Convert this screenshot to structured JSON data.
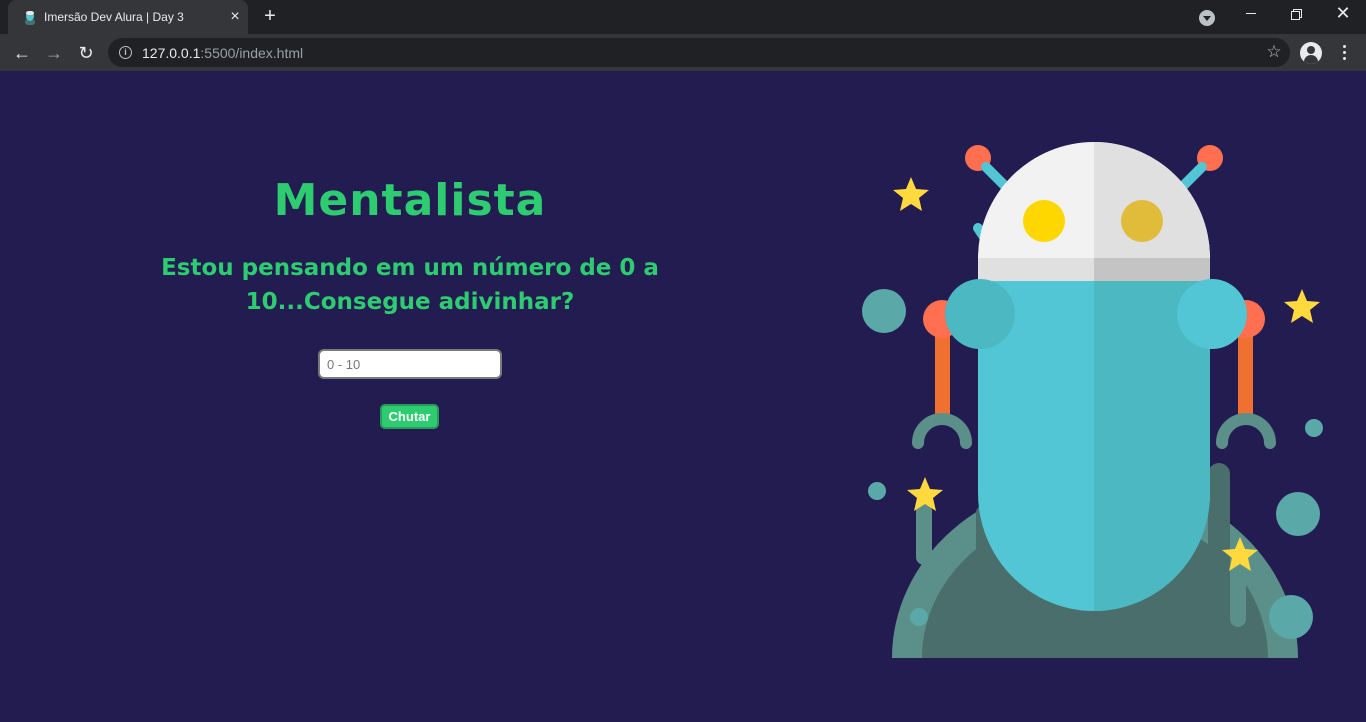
{
  "browser": {
    "tab_title": "Imersão Dev Alura | Day 3",
    "tab_close_icon": "×",
    "new_tab_icon": "+",
    "url_host": "127.0.0.1",
    "url_rest": ":5500/index.html",
    "close_glyph": "✕",
    "back_glyph": "←",
    "forward_glyph": "→",
    "reload_glyph": "↻",
    "star_glyph": "☆",
    "info_glyph": "i"
  },
  "page": {
    "title": "Mentalista",
    "subtitle": "Estou pensando em um número de 0 a 10...Consegue adivinhar?",
    "input_placeholder": "0 - 10",
    "button_label": "Chutar",
    "colors": {
      "background": "#231c50",
      "accent": "#2ecc71"
    },
    "illustration": "robot-illustration"
  }
}
